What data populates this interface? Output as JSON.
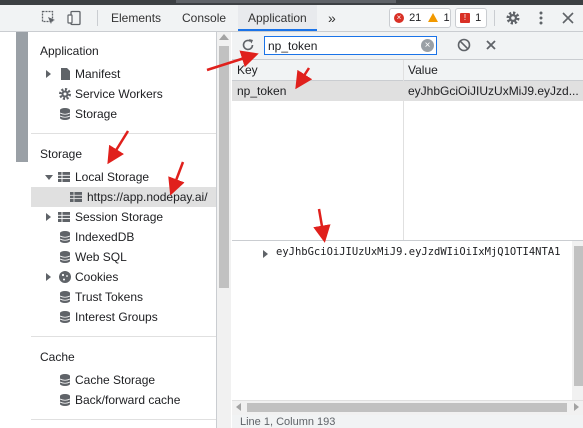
{
  "tabs": {
    "elements": "Elements",
    "console": "Console",
    "application": "Application",
    "more": "»"
  },
  "badges": {
    "errors": "21",
    "warnings": "1",
    "issues": "1"
  },
  "sidebar": {
    "application": {
      "title": "Application",
      "items": [
        "Manifest",
        "Service Workers",
        "Storage"
      ]
    },
    "storage": {
      "title": "Storage",
      "local_storage": "Local Storage",
      "local_storage_origin": "https://app.nodepay.ai/",
      "session_storage": "Session Storage",
      "indexeddb": "IndexedDB",
      "websql": "Web SQL",
      "cookies": "Cookies",
      "trust_tokens": "Trust Tokens",
      "interest_groups": "Interest Groups"
    },
    "cache": {
      "title": "Cache",
      "cache_storage": "Cache Storage",
      "bfcache": "Back/forward cache"
    }
  },
  "toolbar": {
    "filter_value": "np_token"
  },
  "table": {
    "headers": [
      "Key",
      "Value"
    ],
    "rows": [
      {
        "key": "np_token",
        "value": "eyJhbGciOiJIUzUxMiJ9.eyJzd..."
      }
    ]
  },
  "preview": {
    "value": "eyJhbGciOiJIUzUxMiJ9.eyJzdWIiOiIxMjQ1OTI4NTA1"
  },
  "status": {
    "text": "Line 1, Column 193"
  },
  "colors": {
    "accent": "#1a73e8",
    "annotation": "#e0201c",
    "error": "#d93025",
    "warning": "#f29900"
  }
}
